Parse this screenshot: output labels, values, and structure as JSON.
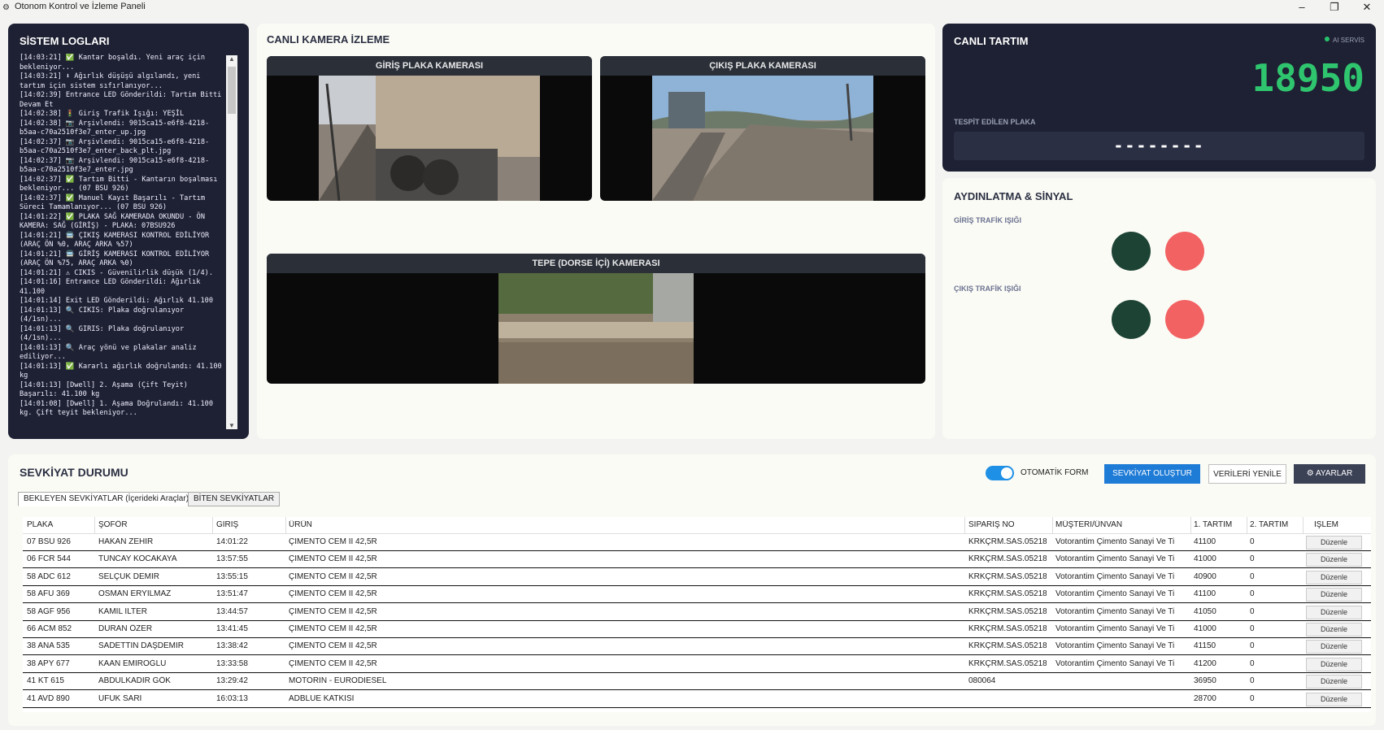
{
  "window": {
    "title": "Otonom Kontrol ve İzleme Paneli"
  },
  "logs": {
    "title": "SİSTEM LOGLARI",
    "lines": [
      "[14:03:21] ✅ Kantar boşaldı. Yeni araç için bekleniyor...",
      "[14:03:21] ⬇ Ağırlık düşüşü algılandı, yeni tartım için sistem sıfırlanıyor...",
      "[14:02:39] Entrance LED Gönderildi: Tartim Bitti Devam Et",
      "[14:02:38] 🚦 Giriş Trafik Işığı: YEŞİL",
      "[14:02:38] 📷 Arşivlendi: 9015ca15-e6f8-4218-b5aa-c70a2510f3e7_enter_up.jpg",
      "[14:02:37] 📷 Arşivlendi: 9015ca15-e6f8-4218-b5aa-c70a2510f3e7_enter_back_plt.jpg",
      "[14:02:37] 📷 Arşivlendi: 9015ca15-e6f8-4218-b5aa-c70a2510f3e7_enter.jpg",
      "[14:02:37] ✅ Tartım Bitti - Kantarın boşalması bekleniyor... (07 BSU 926)",
      "[14:02:37] ✅ Manuel Kayıt Başarılı - Tartım Süreci Tamamlanıyor... (07 BSU 926)",
      "[14:01:22] ✅ PLAKA SAĞ KAMERADA OKUNDU - ÖN KAMERA: SAĞ (GİRİŞ) - PLAKA: 07BSU926",
      "[14:01:21] 🚍 ÇIKIŞ KAMERASI KONTROL EDİLİYOR (ARAÇ ÖN %0, ARAÇ ARKA %57)",
      "[14:01:21] 🚍 GİRİŞ KAMERASI KONTROL EDİLİYOR (ARAÇ ÖN %75, ARAÇ ARKA %0)",
      "[14:01:21] ⚠ CIKIS - Güvenilirlik düşük (1/4).",
      "[14:01:16] Entrance LED Gönderildi: Ağırlık 41.100",
      "[14:01:14] Exit LED Gönderildi: Ağırlık 41.100",
      "[14:01:13] 🔍 CIKIS: Plaka doğrulanıyor (4/1sn)...",
      "[14:01:13] 🔍 GIRIS: Plaka doğrulanıyor (4/1sn)...",
      "[14:01:13] 🔍 Araç yönü ve plakalar analiz ediliyor...",
      "[14:01:13] ✅ Kararlı ağırlık doğrulandı: 41.100 kg",
      "[14:01:13] [Dwell] 2. Aşama (Çift Teyit) Başarılı: 41.100 kg",
      "[14:01:08] [Dwell] 1. Aşama Doğrulandı: 41.100 kg. Çift teyit bekleniyor..."
    ]
  },
  "camera": {
    "title": "CANLI KAMERA İZLEME",
    "entry_label": "GİRİŞ PLAKA KAMERASI",
    "exit_label": "ÇIKIŞ PLAKA KAMERASI",
    "top_label": "TEPE (DORSE İÇİ) KAMERASI"
  },
  "weighing": {
    "title": "CANLI TARTIM",
    "ai_status": "AI SERVİS",
    "ai_status_color": "#27c26c",
    "value": "18950",
    "plate_label": "TESPİT EDİLEN PLAKA",
    "plate_value": "--------"
  },
  "lights": {
    "title": "AYDINLATMA & SİNYAL",
    "entry_label": "GİRİŞ TRAFİK IŞIĞI",
    "exit_label": "ÇIKIŞ TRAFİK IŞIĞI",
    "entry_state": {
      "green": "off",
      "red": "on"
    },
    "exit_state": {
      "green": "off",
      "red": "on"
    }
  },
  "shipments": {
    "title": "SEVKİYAT DURUMU",
    "auto_form_label": "OTOMATİK FORM",
    "auto_form_on": true,
    "create_button": "SEVKİYAT OLUŞTUR",
    "refresh_button": "VERİLERİ YENİLE",
    "settings_button": "AYARLAR",
    "tabs": [
      "BEKLEYEN SEVKİYATLAR (İçerideki Araçlar)",
      "BİTEN SEVKİYATLAR"
    ],
    "columns": [
      "PLAKA",
      "ŞOFÖR",
      "GİRİŞ",
      "ÜRÜN",
      "SİPARİŞ NO",
      "MÜŞTERİ/ÜNVAN",
      "1. TARTIM",
      "2. TARTIM",
      "İŞLEM"
    ],
    "edit_label": "Düzenle",
    "rows": [
      [
        "07 BSU 926",
        "HAKAN ZEHİR",
        "14:01:22",
        "ÇİMENTO CEM II 42,5R",
        "KRKÇRM.SAS.05218",
        "Votorantim Çimento Sanayi Ve Ti",
        "41100",
        "0"
      ],
      [
        "06 FCR 544",
        "TUNCAY KOCAKAYA",
        "13:57:55",
        "ÇİMENTO CEM II 42,5R",
        "KRKÇRM.SAS.05218",
        "Votorantim Çimento Sanayi Ve Ti",
        "41000",
        "0"
      ],
      [
        "58 ADC 612",
        "SELÇUK DEMİR",
        "13:55:15",
        "ÇİMENTO CEM II 42,5R",
        "KRKÇRM.SAS.05218",
        "Votorantim Çimento Sanayi Ve Ti",
        "40900",
        "0"
      ],
      [
        "58 AFU 369",
        "OSMAN ERYILMAZ",
        "13:51:47",
        "ÇİMENTO CEM II 42,5R",
        "KRKÇRM.SAS.05218",
        "Votorantim Çimento Sanayi Ve Ti",
        "41100",
        "0"
      ],
      [
        "58 AGF 956",
        "KAMİL İLTER",
        "13:44:57",
        "ÇİMENTO CEM II 42,5R",
        "KRKÇRM.SAS.05218",
        "Votorantim Çimento Sanayi Ve Ti",
        "41050",
        "0"
      ],
      [
        "66 ACM 852",
        "DURAN ÖZER",
        "13:41:45",
        "ÇİMENTO CEM II 42,5R",
        "KRKÇRM.SAS.05218",
        "Votorantim Çimento Sanayi Ve Ti",
        "41000",
        "0"
      ],
      [
        "38 ANA 535",
        "SADETTİN DAŞDEMİR",
        "13:38:42",
        "ÇİMENTO CEM II 42,5R",
        "KRKÇRM.SAS.05218",
        "Votorantim Çimento Sanayi Ve Ti",
        "41150",
        "0"
      ],
      [
        "38 APY 677",
        "KAAN EMİROĞLU",
        "13:33:58",
        "ÇİMENTO CEM II 42,5R",
        "KRKÇRM.SAS.05218",
        "Votorantim Çimento Sanayi Ve Ti",
        "41200",
        "0"
      ],
      [
        "41 KT 615",
        "ABDULKADİR GÖK",
        "13:29:42",
        "MOTORİN - EURODIESEL",
        "080064",
        "",
        "36950",
        "0"
      ],
      [
        "41 AVD 890",
        "UFUK SARI",
        "16:03:13",
        "ADBLUE KATKISI",
        "",
        "",
        "28700",
        "0"
      ]
    ]
  }
}
